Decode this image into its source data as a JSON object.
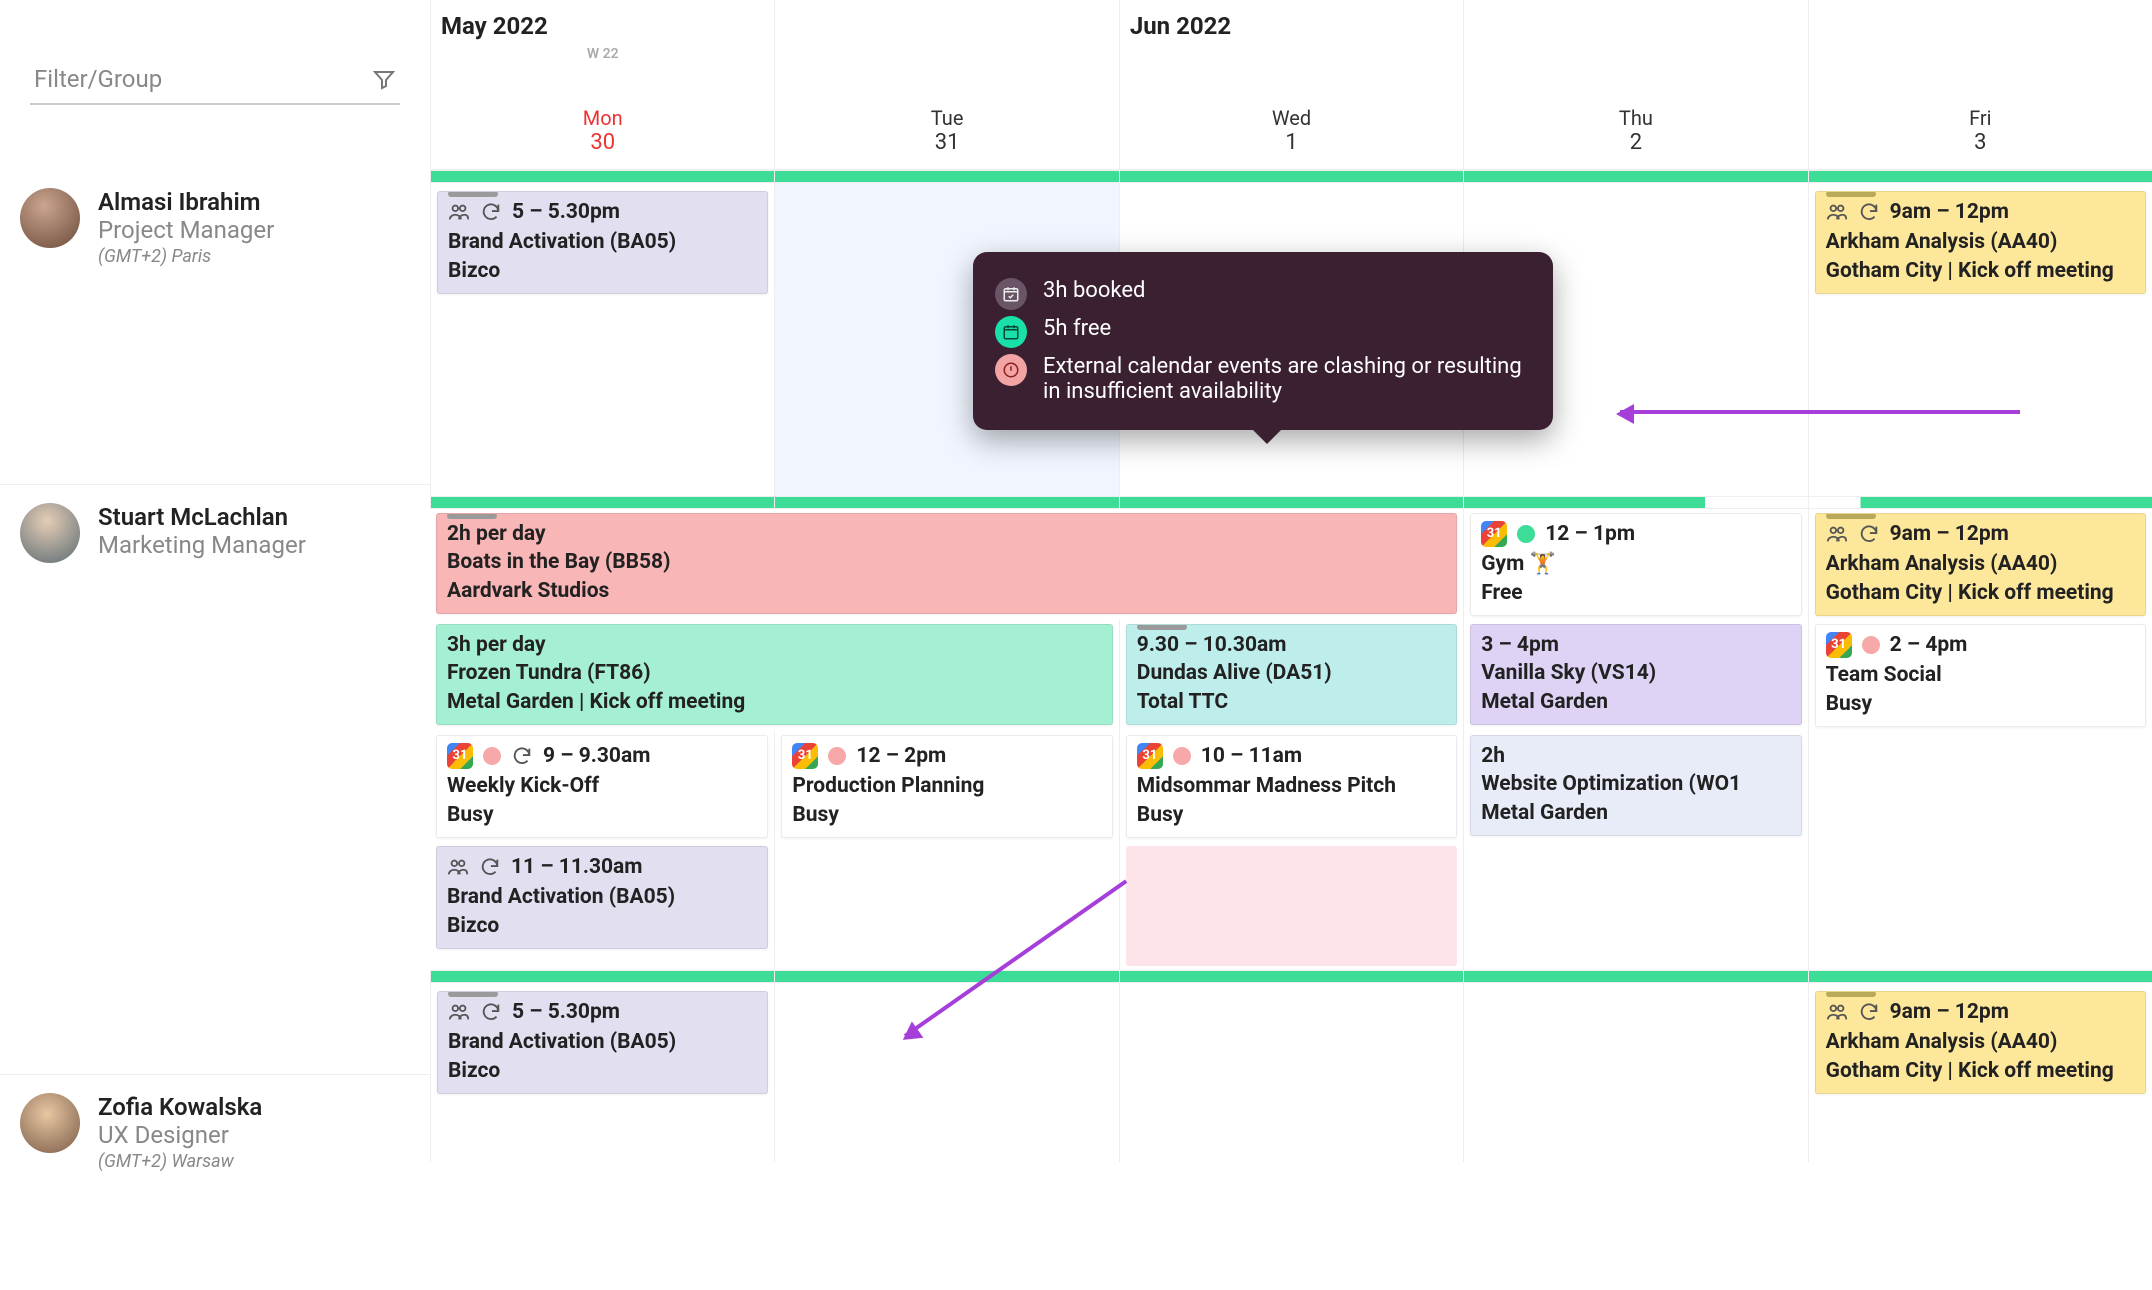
{
  "filter": {
    "placeholder": "Filter/Group"
  },
  "months": {
    "left": "May 2022",
    "right": "Jun 2022"
  },
  "weekLabel": "W 22",
  "days": [
    {
      "dow": "Mon",
      "dom": "30",
      "today": true
    },
    {
      "dow": "Tue",
      "dom": "31"
    },
    {
      "dow": "Wed",
      "dom": "1"
    },
    {
      "dow": "Thu",
      "dom": "2"
    },
    {
      "dow": "Fri",
      "dom": "3"
    }
  ],
  "persons": [
    {
      "name": "Almasi Ibrahim",
      "role": "Project Manager",
      "tz": "(GMT+2) Paris"
    },
    {
      "name": "Stuart McLachlan",
      "role": "Marketing Manager",
      "tz": ""
    },
    {
      "name": "Zofia Kowalska",
      "role": "UX Designer",
      "tz": "(GMT+2) Warsaw"
    }
  ],
  "events": {
    "p1_mon_a": {
      "time": "5 – 5.30pm",
      "title": "Brand Activation (BA05)",
      "client": "Bizco"
    },
    "p1_fri_a": {
      "time": "9am – 12pm",
      "title": "Arkham Analysis (AA40)",
      "client": "Gotham City | Kick off meeting"
    },
    "p2_span_pink": {
      "time": "2h per day",
      "title": "Boats in the Bay (BB58)",
      "client": "Aardvark Studios"
    },
    "p2_span_mint": {
      "time": "3h per day",
      "title": "Frozen Tundra (FT86)",
      "client": "Metal Garden | Kick off meeting"
    },
    "p2_wed_teal": {
      "time": "9.30 – 10.30am",
      "title": "Dundas Alive (DA51)",
      "client": "Total TTC"
    },
    "p2_thu_lav": {
      "time": "3 – 4pm",
      "title": "Vanilla Sky (VS14)",
      "client": "Metal Garden"
    },
    "p2_thu_gym": {
      "time": "12 – 1pm",
      "title": "Gym 🏋️",
      "status": "Free"
    },
    "p2_thu_web": {
      "time": "2h",
      "title": "Website Optimization (WO1",
      "client": "Metal Garden"
    },
    "p2_fri_a": {
      "time": "9am – 12pm",
      "title": "Arkham Analysis (AA40)",
      "client": "Gotham City | Kick off meeting"
    },
    "p2_fri_social": {
      "time": "2 – 4pm",
      "title": "Team Social",
      "status": "Busy"
    },
    "p2_mon_wk": {
      "time": "9 – 9.30am",
      "title": "Weekly Kick-Off",
      "status": "Busy"
    },
    "p2_tue_pp": {
      "time": "12 – 2pm",
      "title": "Production Planning",
      "status": "Busy"
    },
    "p2_wed_mm": {
      "time": "10 – 11am",
      "title": "Midsommar Madness Pitch",
      "status": "Busy"
    },
    "p2_mon_ba": {
      "time": "11 – 11.30am",
      "title": "Brand Activation (BA05)",
      "client": "Bizco"
    },
    "p3_mon_a": {
      "time": "5 – 5.30pm",
      "title": "Brand Activation (BA05)",
      "client": "Bizco"
    },
    "p3_fri_a": {
      "time": "9am – 12pm",
      "title": "Arkham Analysis (AA40)",
      "client": "Gotham City | Kick off meeting"
    }
  },
  "popover": {
    "booked": "3h booked",
    "free": "5h free",
    "warn": "External calendar events are clashing or resulting in insufficient availability"
  }
}
